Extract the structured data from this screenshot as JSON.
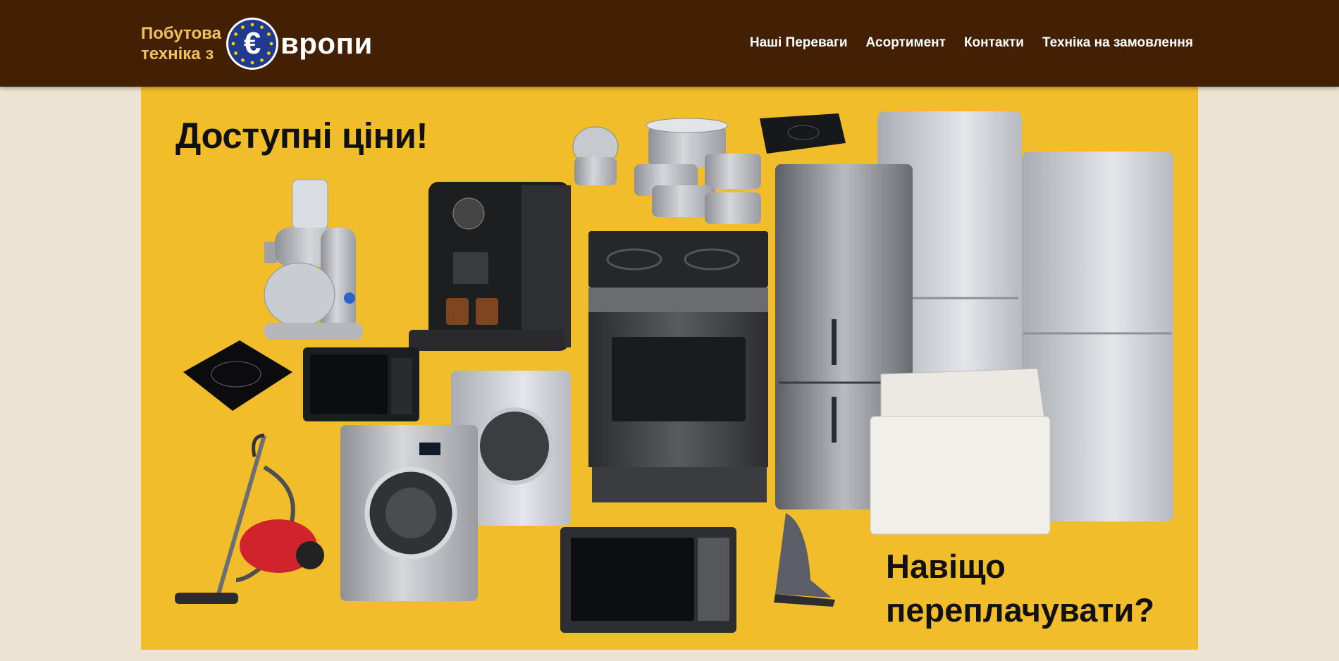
{
  "header": {
    "logo": {
      "line1": "Побутова",
      "line2": "техніка з",
      "euro_symbol": "€",
      "tail": "вропи"
    },
    "nav": [
      {
        "label": "Наші Переваги"
      },
      {
        "label": "Асортимент"
      },
      {
        "label": "Контакти"
      },
      {
        "label": "Техніка на замовлення"
      }
    ]
  },
  "banner": {
    "headline": "Доступні ціни!",
    "tagline_line1": "Навіщо",
    "tagline_line2": "переплачувати?",
    "products": [
      "food-processor-icon",
      "coffee-machine-icon",
      "cookware-set-icon",
      "induction-hob-icon",
      "refrigerator-icon",
      "electric-stove-icon",
      "microwave-icon",
      "washing-machine-icon",
      "vacuum-cleaner-icon",
      "chest-freezer-icon",
      "iron-icon"
    ]
  },
  "colors": {
    "header_bg": "#432004",
    "logo_gold": "#eec15f",
    "banner_bg": "#f1bd2b",
    "page_bg": "#ece3d3",
    "euro_blue": "#1f3a8f"
  }
}
